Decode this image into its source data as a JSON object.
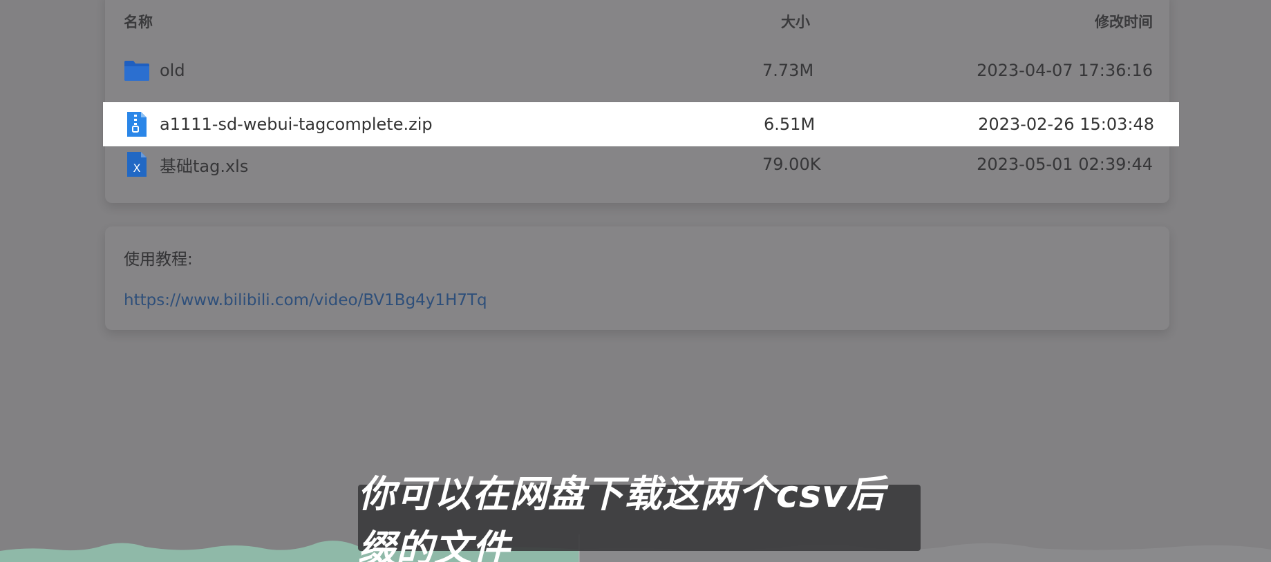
{
  "table": {
    "headers": {
      "name": "名称",
      "size": "大小",
      "modified": "修改时间"
    },
    "rows": [
      {
        "name": "old",
        "size": "7.73M",
        "modified": "2023-04-07 17:36:16",
        "icon": "folder-icon"
      },
      {
        "name": "a1111-sd-webui-tagcomplete.zip",
        "size": "6.51M",
        "modified": "2023-02-26 15:03:48",
        "icon": "zip-file-icon"
      },
      {
        "name": "基础tag.xls",
        "size": "79.00K",
        "modified": "2023-05-01 02:39:44",
        "icon": "excel-file-icon"
      }
    ]
  },
  "tutorial": {
    "label": "使用教程:",
    "link": "https://www.bilibili.com/video/BV1Bg4y1H7Tq"
  },
  "subtitle": {
    "text": "你可以在网盘下载这两个csv后缀的文件"
  },
  "colors": {
    "overlay": "#828183",
    "highlight": "#ffffff",
    "folder_blue": "#1f63c4",
    "file_blue": "#2a7bdc",
    "waveform_green": "#8fb9a8"
  }
}
